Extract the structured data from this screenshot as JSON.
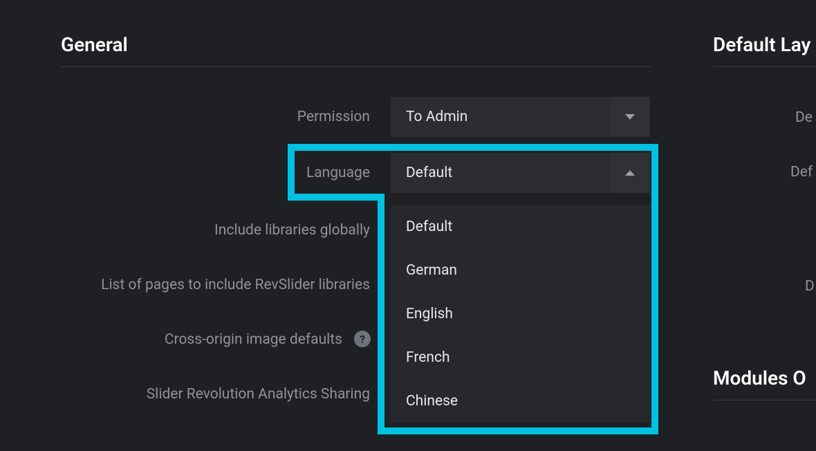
{
  "general": {
    "title": "General",
    "fields": {
      "permission_label": "Permission",
      "permission_value": "To Admin",
      "language_label": "Language",
      "language_value": "Default",
      "include_libraries_label": "Include libraries globally",
      "list_pages_label": "List of pages to include RevSlider libraries",
      "cross_origin_label": "Cross-origin image defaults",
      "analytics_label": "Slider Revolution Analytics Sharing"
    },
    "language_options": [
      "Default",
      "German",
      "English",
      "French",
      "Chinese"
    ]
  },
  "right": {
    "default_lay_title": "Default Lay",
    "de_label_1": "De",
    "def_label_2": "Def",
    "d_label_3": "D",
    "modules_title": "Modules O"
  }
}
